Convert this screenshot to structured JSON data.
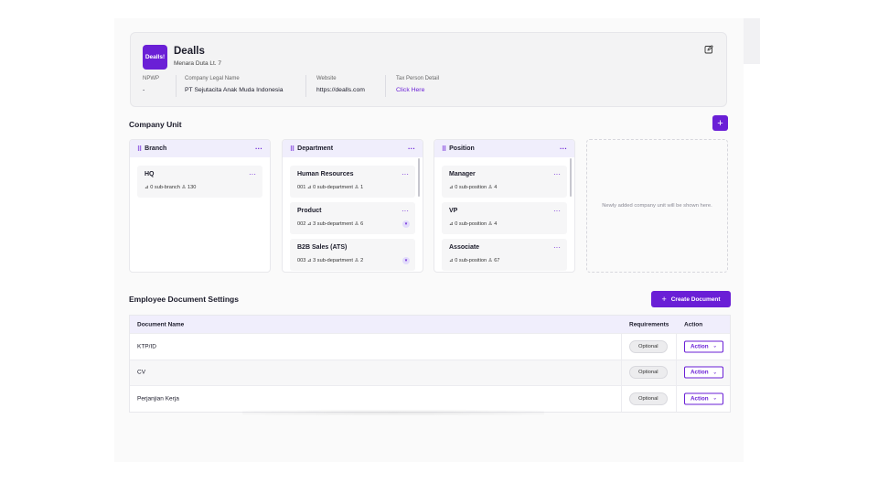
{
  "company": {
    "logo_text": "Dealls!",
    "name": "Dealls",
    "address": "Menara Duta Lt. 7",
    "fields": [
      {
        "label": "NPWP",
        "value": "-"
      },
      {
        "label": "Company Legal Name",
        "value": "PT Sejutacita Anak Muda Indonesia"
      },
      {
        "label": "Website",
        "value": "https://dealls.com"
      },
      {
        "label": "Tax Person Detail",
        "value": "Click Here"
      }
    ],
    "edit_icon": "edit-icon"
  },
  "company_unit": {
    "title": "Company Unit",
    "add_label": "+",
    "columns": [
      {
        "title": "Branch",
        "items": [
          {
            "name": "HQ",
            "meta": "⊿ 0 sub-branch   ♙ 130"
          }
        ]
      },
      {
        "title": "Department",
        "items": [
          {
            "name": "Human Resources",
            "meta": "001   ⊿ 0 sub-department   ♙ 1"
          },
          {
            "name": "Product",
            "meta": "002   ⊿ 3 sub-department   ♙ 6"
          },
          {
            "name": "B2B Sales (ATS)",
            "meta": "003   ⊿ 3 sub-department   ♙ 2"
          }
        ]
      },
      {
        "title": "Position",
        "items": [
          {
            "name": "Manager",
            "meta": "⊿ 0 sub-position   ♙ 4"
          },
          {
            "name": "VP",
            "meta": "⊿ 0 sub-position   ♙ 4"
          },
          {
            "name": "Associate",
            "meta": "⊿ 0 sub-position   ♙ 67"
          }
        ]
      }
    ],
    "empty_text": "Newly added company unit will be shown here."
  },
  "documents": {
    "title": "Employee Document Settings",
    "create_label": "Create Document",
    "create_icon": "+",
    "headers": [
      "Document Name",
      "Requirements",
      "Action"
    ],
    "rows": [
      {
        "name": "KTP/ID",
        "requirement": "Optional",
        "action": "Action"
      },
      {
        "name": "CV",
        "requirement": "Optional",
        "action": "Action"
      },
      {
        "name": "Perjanjian Kerja",
        "requirement": "Optional",
        "action": "Action"
      }
    ]
  },
  "colors": {
    "accent": "#6a1fd6",
    "header_bg": "#f0eefc"
  }
}
